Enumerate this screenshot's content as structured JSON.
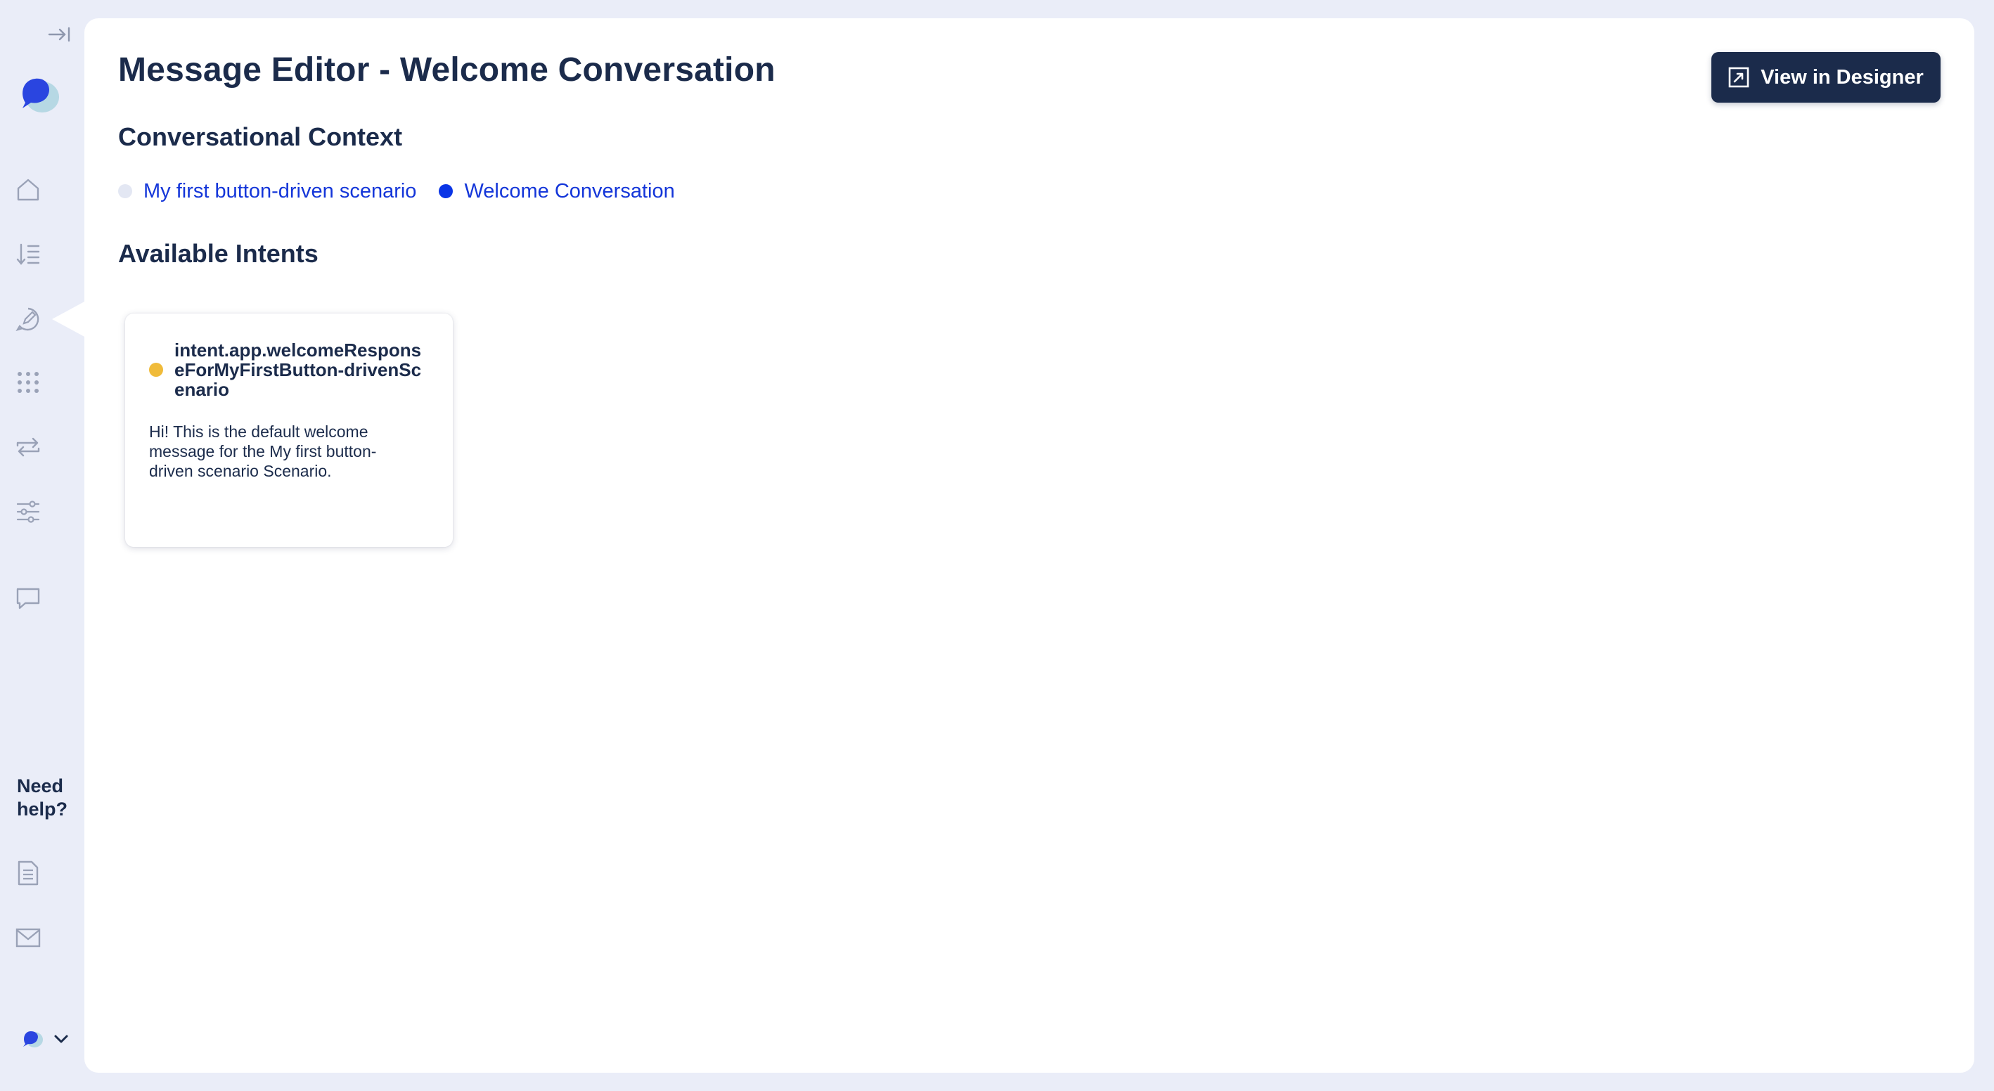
{
  "sidebar": {
    "help_label": "Need help?"
  },
  "main": {
    "title": "Message Editor - Welcome Conversation",
    "designer_button_label": "View in Designer",
    "context_title": "Conversational Context",
    "breadcrumbs": [
      {
        "label": "My first button-driven scenario"
      },
      {
        "label": "Welcome Conversation"
      }
    ],
    "intents_title": "Available Intents",
    "intents": [
      {
        "name": "intent.app.welcomeResponseForMyFirstButton-drivenScenario",
        "description": "Hi! This is the default welcome message for the My first button-driven scenario Scenario."
      }
    ]
  },
  "colors": {
    "navy": "#1b2b4b",
    "link_blue": "#1436d9",
    "active_dot": "#0a35e6",
    "intent_status": "#f0bb3a",
    "background": "#eaedf8"
  }
}
